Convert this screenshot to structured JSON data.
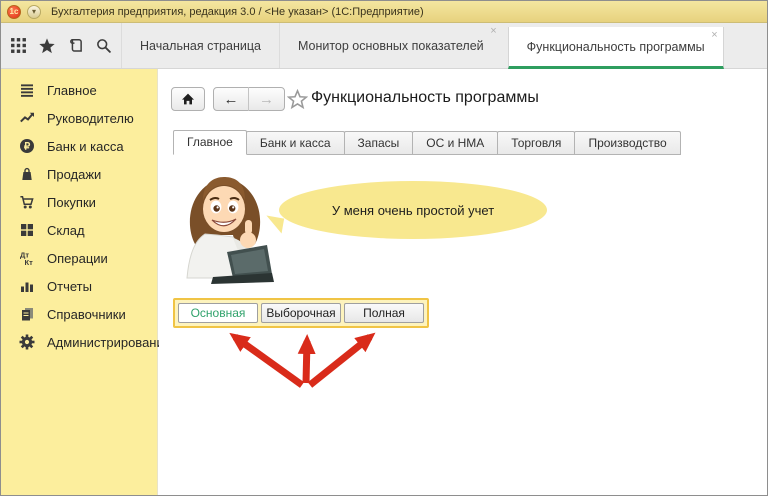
{
  "window": {
    "title": "Бухгалтерия предприятия, редакция 3.0 / <Не указан>  (1С:Предприятие)",
    "logo_text": "1с",
    "menu_chevron": "▾"
  },
  "tabbar": {
    "tabs": [
      {
        "label": "Начальная страница",
        "closable": false,
        "active": false
      },
      {
        "label": "Монитор основных показателей",
        "close": "×",
        "closable": true,
        "active": false
      },
      {
        "label": "Функциональность программы",
        "close": "×",
        "closable": true,
        "active": true
      }
    ]
  },
  "sidebar": {
    "items": [
      {
        "label": "Главное",
        "icon": "menu-lines-icon"
      },
      {
        "label": "Руководителю",
        "icon": "trend-up-icon"
      },
      {
        "label": "Банк и касса",
        "icon": "ruble-circle-icon"
      },
      {
        "label": "Продажи",
        "icon": "shopping-bag-icon"
      },
      {
        "label": "Покупки",
        "icon": "shopping-cart-icon"
      },
      {
        "label": "Склад",
        "icon": "grid-boxes-icon"
      },
      {
        "label": "Операции",
        "icon": "debit-credit-icon"
      },
      {
        "label": "Отчеты",
        "icon": "bar-chart-icon"
      },
      {
        "label": "Справочники",
        "icon": "books-icon"
      },
      {
        "label": "Администрирование",
        "icon": "gear-icon"
      }
    ],
    "icon_glyphs": {
      "ruble": "₽",
      "dt": "Дт",
      "kt": "Кт"
    }
  },
  "content": {
    "nav": {
      "back": "←",
      "forward": "→"
    },
    "page_title": "Функциональность программы",
    "section_tabs": [
      {
        "label": "Главное",
        "active": true
      },
      {
        "label": "Банк и касса",
        "active": false
      },
      {
        "label": "Запасы",
        "active": false
      },
      {
        "label": "ОС и НМА",
        "active": false
      },
      {
        "label": "Торговля",
        "active": false
      },
      {
        "label": "Производство",
        "active": false
      }
    ],
    "assistant_bubble": "У меня очень простой учет",
    "functionality_options": [
      {
        "label": "Основная",
        "selected": true
      },
      {
        "label": "Выборочная",
        "selected": false
      },
      {
        "label": "Полная",
        "selected": false
      }
    ]
  },
  "colors": {
    "titlebar": "#eedc8b",
    "sidebar": "#fcee9d",
    "active_tab_underline": "#2e9e5f",
    "selected_option_text": "#2fa26b",
    "highlight_border": "#f0c445",
    "highlight_fill": "#fdf3bd",
    "bubble": "#f8e88f",
    "annotation_arrow": "#d92b1a"
  }
}
